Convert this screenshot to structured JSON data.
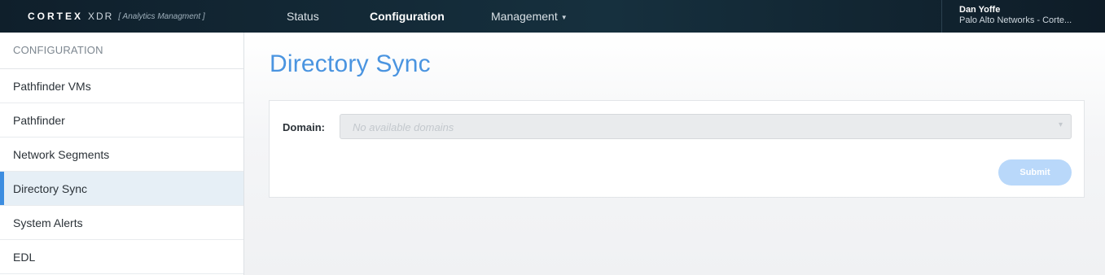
{
  "app": {
    "brand_name": "CORTEX",
    "brand_product": "XDR",
    "brand_subtitle": "[ Analytics Managment ]"
  },
  "nav": {
    "status": "Status",
    "configuration": "Configuration",
    "management": "Management",
    "management_icon": "caret-down-icon"
  },
  "user": {
    "name": "Dan Yoffe",
    "org": "Palo Alto Networks - Corte..."
  },
  "sidebar": {
    "heading": "CONFIGURATION",
    "active_index": 3,
    "items": [
      {
        "label": "Pathfinder VMs"
      },
      {
        "label": "Pathfinder"
      },
      {
        "label": "Network Segments"
      },
      {
        "label": "Directory Sync"
      },
      {
        "label": "System Alerts"
      },
      {
        "label": "EDL"
      }
    ]
  },
  "main": {
    "title": "Directory Sync",
    "domain_label": "Domain:",
    "domain_placeholder": "No available domains",
    "domain_disabled": true,
    "submit_label": "Submit",
    "submit_disabled": true
  },
  "colors": {
    "accent": "#4a94e0",
    "active_bar": "#3d8de0",
    "topbar": "#12283a",
    "submit_disabled": "#b9d8fa"
  }
}
